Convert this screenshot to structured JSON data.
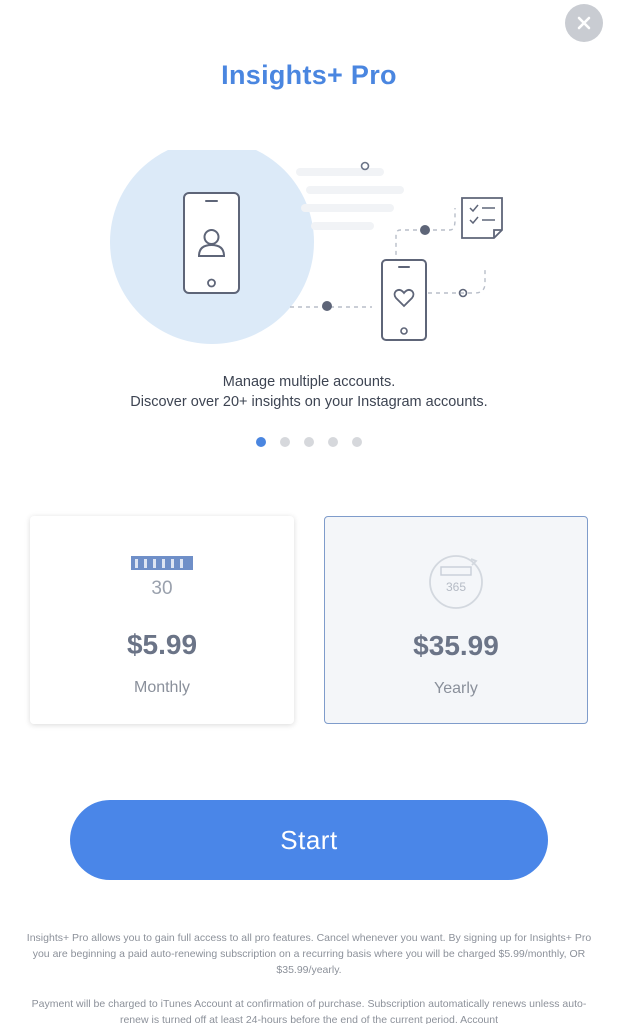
{
  "header": {
    "title": "Insights+ Pro",
    "close_icon": "close-icon"
  },
  "feature": {
    "line1": "Manage multiple accounts.",
    "line2": "Discover over 20+ insights on your Instagram accounts.",
    "page_count": 5,
    "active_page": 1
  },
  "plans": {
    "monthly": {
      "icon": "calendar-icon",
      "icon_number": "30",
      "price": "$5.99",
      "period": "Monthly"
    },
    "yearly": {
      "icon": "calendar-refresh-icon",
      "icon_number": "365",
      "price": "$35.99",
      "period": "Yearly",
      "selected": true
    }
  },
  "cta": {
    "label": "Start"
  },
  "legal": {
    "p1": "Insights+ Pro allows you to gain full access to all pro features. Cancel whenever you want. By signing up for Insights+ Pro you are beginning a paid auto-renewing subscription on a recurring basis where you will be charged $5.99/monthly, OR $35.99/yearly.",
    "p2": "Payment will be charged to iTunes Account at confirmation of purchase. Subscription automatically renews unless auto-renew is turned off at least 24-hours before the end of the current period. Account"
  },
  "colors": {
    "accent": "#4a86e8",
    "title": "#4a86e0",
    "circle": "#dceaf8",
    "close_bg": "#c9ccd2"
  }
}
